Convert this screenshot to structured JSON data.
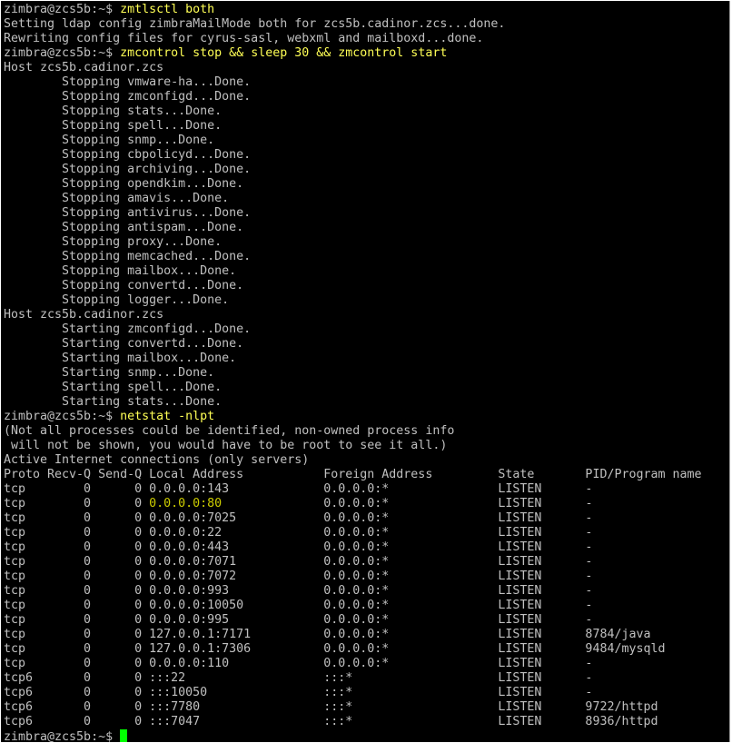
{
  "terminal": {
    "prompt": "zimbra@zcs5b:~$ ",
    "colors": {
      "background": "#000000",
      "text": "#c0c0c0",
      "command": "#ffff55",
      "highlight": "#cdcd00",
      "cursor": "#00ff00"
    },
    "lines": [
      {
        "type": "prompt",
        "text": "zimbra@zcs5b:~$ ",
        "command": "zmtlsctl both"
      },
      {
        "type": "output",
        "text": "Setting ldap config zimbraMailMode both for zcs5b.cadinor.zcs...done."
      },
      {
        "type": "output",
        "text": "Rewriting config files for cyrus-sasl, webxml and mailboxd...done."
      },
      {
        "type": "prompt",
        "text": "zimbra@zcs5b:~$ ",
        "command": "zmcontrol stop && sleep 30 && zmcontrol start"
      },
      {
        "type": "output",
        "text": "Host zcs5b.cadinor.zcs"
      },
      {
        "type": "output",
        "text": "        Stopping vmware-ha...Done."
      },
      {
        "type": "output",
        "text": "        Stopping zmconfigd...Done."
      },
      {
        "type": "output",
        "text": "        Stopping stats...Done."
      },
      {
        "type": "output",
        "text": "        Stopping spell...Done."
      },
      {
        "type": "output",
        "text": "        Stopping snmp...Done."
      },
      {
        "type": "output",
        "text": "        Stopping cbpolicyd...Done."
      },
      {
        "type": "output",
        "text": "        Stopping archiving...Done."
      },
      {
        "type": "output",
        "text": "        Stopping opendkim...Done."
      },
      {
        "type": "output",
        "text": "        Stopping amavis...Done."
      },
      {
        "type": "output",
        "text": "        Stopping antivirus...Done."
      },
      {
        "type": "output",
        "text": "        Stopping antispam...Done."
      },
      {
        "type": "output",
        "text": "        Stopping proxy...Done."
      },
      {
        "type": "output",
        "text": "        Stopping memcached...Done."
      },
      {
        "type": "output",
        "text": "        Stopping mailbox...Done."
      },
      {
        "type": "output",
        "text": "        Stopping convertd...Done."
      },
      {
        "type": "output",
        "text": "        Stopping logger...Done."
      },
      {
        "type": "output",
        "text": "Host zcs5b.cadinor.zcs"
      },
      {
        "type": "output",
        "text": "        Starting zmconfigd...Done."
      },
      {
        "type": "output",
        "text": "        Starting convertd...Done."
      },
      {
        "type": "output",
        "text": "        Starting mailbox...Done."
      },
      {
        "type": "output",
        "text": "        Starting snmp...Done."
      },
      {
        "type": "output",
        "text": "        Starting spell...Done."
      },
      {
        "type": "output",
        "text": "        Starting stats...Done."
      },
      {
        "type": "prompt",
        "text": "zimbra@zcs5b:~$ ",
        "command": "netstat -nlpt"
      },
      {
        "type": "output",
        "text": "(Not all processes could be identified, non-owned process info"
      },
      {
        "type": "output",
        "text": " will not be shown, you would have to be root to see it all.)"
      },
      {
        "type": "output",
        "text": "Active Internet connections (only servers)"
      },
      {
        "type": "output",
        "text": "Proto Recv-Q Send-Q Local Address           Foreign Address         State       PID/Program name"
      },
      {
        "type": "output",
        "text": "tcp        0      0 0.0.0.0:143             0.0.0.0:*               LISTEN      -"
      },
      {
        "type": "highlight",
        "before": "tcp        0      0 ",
        "highlight": "0.0.0.0:80",
        "after": "              0.0.0.0:*               LISTEN      -"
      },
      {
        "type": "output",
        "text": "tcp        0      0 0.0.0.0:7025            0.0.0.0:*               LISTEN      -"
      },
      {
        "type": "output",
        "text": "tcp        0      0 0.0.0.0:22              0.0.0.0:*               LISTEN      -"
      },
      {
        "type": "output",
        "text": "tcp        0      0 0.0.0.0:443             0.0.0.0:*               LISTEN      -"
      },
      {
        "type": "output",
        "text": "tcp        0      0 0.0.0.0:7071            0.0.0.0:*               LISTEN      -"
      },
      {
        "type": "output",
        "text": "tcp        0      0 0.0.0.0:7072            0.0.0.0:*               LISTEN      -"
      },
      {
        "type": "output",
        "text": "tcp        0      0 0.0.0.0:993             0.0.0.0:*               LISTEN      -"
      },
      {
        "type": "output",
        "text": "tcp        0      0 0.0.0.0:10050           0.0.0.0:*               LISTEN      -"
      },
      {
        "type": "output",
        "text": "tcp        0      0 0.0.0.0:995             0.0.0.0:*               LISTEN      -"
      },
      {
        "type": "output",
        "text": "tcp        0      0 127.0.0.1:7171          0.0.0.0:*               LISTEN      8784/java"
      },
      {
        "type": "output",
        "text": "tcp        0      0 127.0.0.1:7306          0.0.0.0:*               LISTEN      9484/mysqld"
      },
      {
        "type": "output",
        "text": "tcp        0      0 0.0.0.0:110             0.0.0.0:*               LISTEN      -"
      },
      {
        "type": "output",
        "text": "tcp6       0      0 :::22                   :::*                    LISTEN      -"
      },
      {
        "type": "output",
        "text": "tcp6       0      0 :::10050                :::*                    LISTEN      -"
      },
      {
        "type": "output",
        "text": "tcp6       0      0 :::7780                 :::*                    LISTEN      9722/httpd"
      },
      {
        "type": "output",
        "text": "tcp6       0      0 :::7047                 :::*                    LISTEN      8936/httpd"
      },
      {
        "type": "cursor",
        "text": "zimbra@zcs5b:~$ "
      }
    ]
  }
}
